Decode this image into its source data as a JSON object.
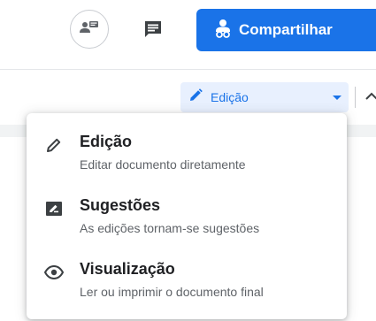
{
  "header": {
    "share_label": "Compartilhar",
    "meet_icon": "meet-present-icon",
    "comment_icon": "comment-icon",
    "share_icon": "people-icon"
  },
  "toolbar": {
    "mode_label": "Edição",
    "mode_icon": "pencil-icon",
    "caret_icon": "caret-down-icon",
    "collapse_icon": "chevron-up-icon"
  },
  "menu": {
    "items": [
      {
        "title": "Edição",
        "description": "Editar documento diretamente",
        "icon": "pencil-icon"
      },
      {
        "title": "Sugestões",
        "description": "As edições tornam-se sugestões",
        "icon": "suggest-edit-icon"
      },
      {
        "title": "Visualização",
        "description": "Ler ou imprimir o documento final",
        "icon": "eye-icon"
      }
    ]
  },
  "colors": {
    "accent": "#1a73e8",
    "accent_light": "#e8f0fe",
    "text_primary": "#202124",
    "text_secondary": "#5f6368"
  }
}
